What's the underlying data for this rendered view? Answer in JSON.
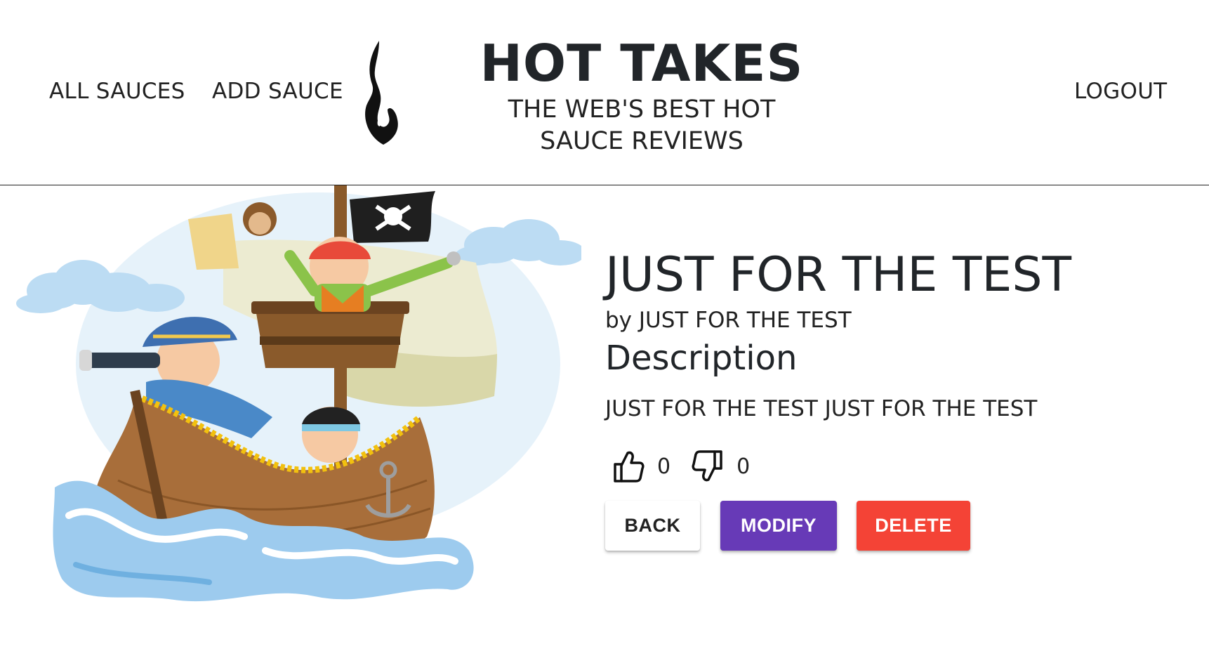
{
  "header": {
    "nav": {
      "all_sauces": "ALL SAUCES",
      "add_sauce": "ADD SAUCE",
      "logout": "LOGOUT"
    },
    "title": "HOT TAKES",
    "subtitle": "THE WEB'S BEST HOT SAUCE REVIEWS",
    "logo_icon": "flame-icon"
  },
  "sauce": {
    "image_icon": "pirate-ship-illustration",
    "name": "JUST FOR THE TEST",
    "manufacturer": "by JUST FOR THE TEST",
    "description_heading": "Description",
    "description": "JUST FOR THE TEST JUST FOR THE TEST",
    "likes": "0",
    "dislikes": "0",
    "like_icon": "thumbs-up-icon",
    "dislike_icon": "thumbs-down-icon"
  },
  "actions": {
    "back": "BACK",
    "modify": "MODIFY",
    "delete": "DELETE"
  },
  "colors": {
    "modify": "#673ab7",
    "delete": "#f44336",
    "text": "#212529"
  }
}
